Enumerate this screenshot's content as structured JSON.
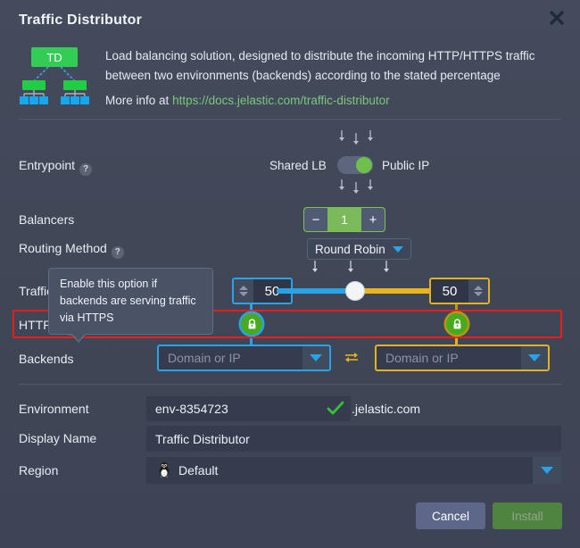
{
  "dialog": {
    "title": "Traffic Distributor",
    "close_icon": "close-icon"
  },
  "info": {
    "icon_label": "TD",
    "description": "Load balancing solution, designed to distribute the incoming HTTP/HTTPS traffic between two environments (backends) according to the stated percentage",
    "more_info_prefix": "More info at",
    "more_info_link": "https://docs.jelastic.com/traffic-distributor"
  },
  "form": {
    "entrypoint": {
      "label": "Entrypoint",
      "help": "?",
      "off_label": "Shared LB",
      "on_label": "Public IP",
      "value": "Public IP"
    },
    "balancers": {
      "label": "Balancers",
      "minus": "−",
      "plus": "+",
      "value": "1"
    },
    "routing_method": {
      "label": "Routing Method",
      "help": "?",
      "value": "Round Robin"
    },
    "traffic": {
      "label": "Traffic",
      "left_value": "50",
      "right_value": "50"
    },
    "https": {
      "label": "HTTPS",
      "help": "?",
      "left_state": "locked",
      "right_state": "locked"
    },
    "backends": {
      "label": "Backends",
      "left_placeholder": "Domain or IP",
      "right_placeholder": "Domain or IP",
      "swap_icon": "swap-icon"
    },
    "environment": {
      "label": "Environment",
      "value": "env-8354723",
      "suffix": ".jelastic.com",
      "valid_icon": "check-icon"
    },
    "display_name": {
      "label": "Display Name",
      "value": "Traffic Distributor"
    },
    "region": {
      "label": "Region",
      "value": "Default",
      "icon": "linux-penguin-icon"
    }
  },
  "tooltip": {
    "text": "Enable this option if backends are serving traffic via HTTPS"
  },
  "footer": {
    "cancel": "Cancel",
    "install": "Install"
  },
  "colors": {
    "accent_blue": "#29a3e8",
    "accent_gold": "#e4b220",
    "green": "#6ebf4b",
    "highlight_red": "#ef1b1b",
    "link_green": "#7ec67e"
  }
}
